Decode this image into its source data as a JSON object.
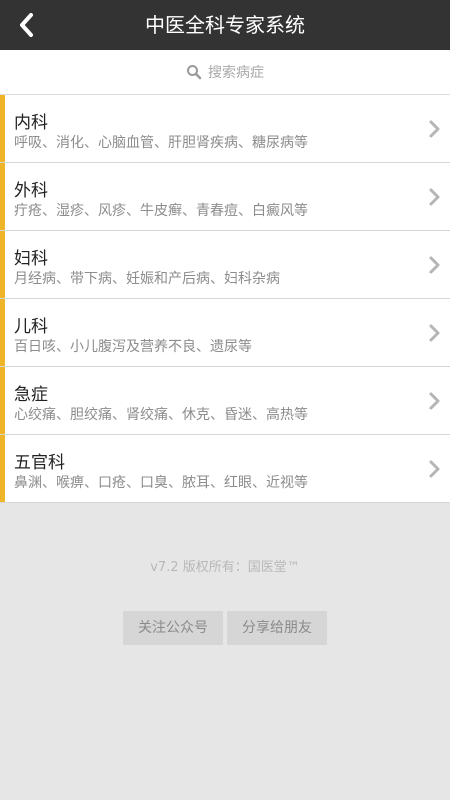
{
  "colors": {
    "header_bg": "#333333",
    "accent": "#f0b429",
    "page_bg": "#e6e6e6"
  },
  "header": {
    "title": "中医全科专家系统",
    "back_icon": "chevron-left-icon"
  },
  "search": {
    "placeholder": "搜索病症",
    "icon": "search-icon"
  },
  "categories": [
    {
      "title": "内科",
      "subtitle": "呼吸、消化、心脑血管、肝胆肾疾病、糖尿病等"
    },
    {
      "title": "外科",
      "subtitle": "疔疮、湿疹、风疹、牛皮癣、青春痘、白癜风等"
    },
    {
      "title": "妇科",
      "subtitle": "月经病、带下病、妊娠和产后病、妇科杂病"
    },
    {
      "title": "儿科",
      "subtitle": "百日咳、小儿腹泻及营养不良、遗尿等"
    },
    {
      "title": "急症",
      "subtitle": "心绞痛、胆绞痛、肾绞痛、休克、昏迷、高热等"
    },
    {
      "title": "五官科",
      "subtitle": "鼻渊、喉痹、口疮、口臭、脓耳、红眼、近视等"
    }
  ],
  "footer": {
    "copyright": "v7.2 版权所有：国医堂™",
    "follow_label": "关注公众号",
    "share_label": "分享给朋友"
  }
}
